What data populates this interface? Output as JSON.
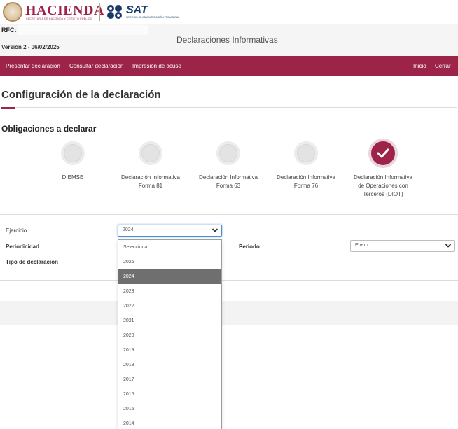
{
  "header": {
    "hacienda_logo": "HACIENDA",
    "hacienda_tagline": "SECRETARÍA DE HACIENDA Y CRÉDITO PÚBLICO",
    "sat_logo": "SAT",
    "sat_tagline": "SERVICIO DE ADMINISTRACIÓN TRIBUTARIA",
    "rfc_label": "RFC:",
    "version": "Versión 2 - 06/02/2025",
    "app_title": "Declaraciones Informativas"
  },
  "navbar": {
    "items": [
      "Presentar declaración",
      "Consultar declaración",
      "Impresión de acuse"
    ],
    "home": "Inicio",
    "logout": "Cerrar"
  },
  "page": {
    "heading": "Configuración de la declaración",
    "section_title": "Obligaciones a declarar"
  },
  "steps": [
    {
      "lines": [
        "DIEMSE"
      ],
      "state": "pending"
    },
    {
      "lines": [
        "Declaración Informativa",
        "Forma 81"
      ],
      "state": "pending"
    },
    {
      "lines": [
        "Declaración Informativa",
        "Forma 63"
      ],
      "state": "pending"
    },
    {
      "lines": [
        "Declaración Informativa",
        "Forma 76"
      ],
      "state": "pending"
    },
    {
      "lines": [
        "Declaración Informativa",
        "de Operaciones con",
        "Terceros (DIOT)"
      ],
      "state": "done"
    }
  ],
  "form": {
    "ejercicio_label": "Ejercicio",
    "ejercicio_value": "2024",
    "periodicidad_label": "Periodicidad",
    "periodo_label": "Periodo",
    "periodo_value": "Enero",
    "tipo_label": "Tipo de declaración"
  },
  "dropdown": {
    "options": [
      "Selecciona",
      "2025",
      "2024",
      "2023",
      "2022",
      "2021",
      "2020",
      "2019",
      "2018",
      "2017",
      "2016",
      "2015",
      "2014"
    ],
    "selected": "2024"
  },
  "colors": {
    "brand": "#9d2449",
    "sat_blue": "#1b3a6b",
    "focus": "#4a90d9"
  }
}
